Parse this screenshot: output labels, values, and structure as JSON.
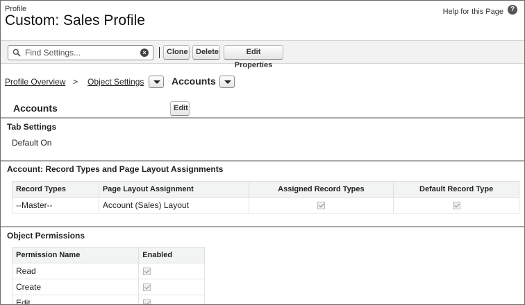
{
  "header": {
    "type_label": "Profile",
    "title": "Custom: Sales Profile",
    "help_link": "Help for this Page",
    "help_icon": "?"
  },
  "toolbar": {
    "search_placeholder": "Find Settings...",
    "clone_label": "Clone",
    "delete_label": "Delete",
    "edit_properties_label": "Edit Properties"
  },
  "breadcrumb": {
    "item1": "Profile Overview",
    "separator": ">",
    "item2": "Object Settings",
    "current": "Accounts"
  },
  "object_section": {
    "title": "Accounts",
    "edit_label": "Edit"
  },
  "tab_settings": {
    "title": "Tab Settings",
    "value": "Default On"
  },
  "record_types": {
    "title": "Account: Record Types and Page Layout Assignments",
    "columns": [
      "Record Types",
      "Page Layout Assignment",
      "Assigned Record Types",
      "Default Record Type"
    ],
    "rows": [
      {
        "record_type": "--Master--",
        "layout": "Account (Sales) Layout",
        "assigned": true,
        "default": true
      }
    ]
  },
  "object_permissions": {
    "title": "Object Permissions",
    "columns": [
      "Permission Name",
      "Enabled"
    ],
    "rows": [
      {
        "name": "Read",
        "enabled": true
      },
      {
        "name": "Create",
        "enabled": true
      },
      {
        "name": "Edit",
        "enabled": true
      }
    ]
  }
}
